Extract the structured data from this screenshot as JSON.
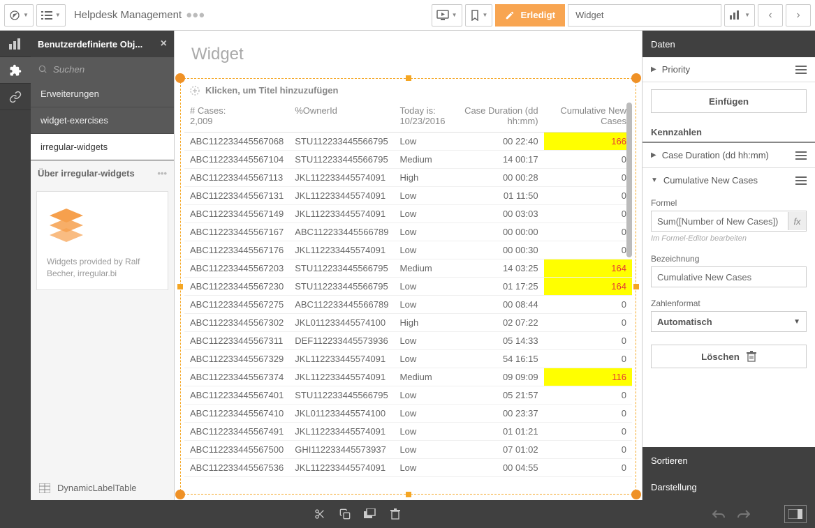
{
  "app_title": "Helpdesk Management",
  "toolbar": {
    "done_label": "Erledigt",
    "widget_label": "Widget"
  },
  "left_panel": {
    "header": "Benutzerdefinierte Obj...",
    "search_placeholder": "Suchen",
    "nav": {
      "erweiterungen": "Erweiterungen",
      "widget_exercises": "widget-exercises",
      "irregular_widgets": "irregular-widgets"
    },
    "about_header": "Über irregular-widgets",
    "about_text": "Widgets provided by Ralf Becher, irregular.bi",
    "content_item": "DynamicLabelTable"
  },
  "canvas": {
    "page_title": "Widget",
    "click_title": "Klicken, um Titel hinzuzufügen",
    "headers": {
      "cases": "# Cases:",
      "cases_count": "2,009",
      "owner": "%OwnerId",
      "today": "Today is:",
      "today_date": "10/23/2016",
      "duration": "Case Duration (dd hh:mm)",
      "cumulative": "Cumulative New Cases"
    },
    "rows": [
      {
        "c1": "ABC112233445567068",
        "c2": "STU112233445566795",
        "c3": "Low",
        "c4": "00 22:40",
        "c5": "166",
        "hl": true
      },
      {
        "c1": "ABC112233445567104",
        "c2": "STU112233445566795",
        "c3": "Medium",
        "c4": "14 00:17",
        "c5": "0",
        "hl": false
      },
      {
        "c1": "ABC112233445567113",
        "c2": "JKL112233445574091",
        "c3": "High",
        "c4": "00 00:28",
        "c5": "0",
        "hl": false
      },
      {
        "c1": "ABC112233445567131",
        "c2": "JKL112233445574091",
        "c3": "Low",
        "c4": "01 11:50",
        "c5": "0",
        "hl": false
      },
      {
        "c1": "ABC112233445567149",
        "c2": "JKL112233445574091",
        "c3": "Low",
        "c4": "00 03:03",
        "c5": "0",
        "hl": false
      },
      {
        "c1": "ABC112233445567167",
        "c2": "ABC112233445566789",
        "c3": "Low",
        "c4": "00 00:00",
        "c5": "0",
        "hl": false
      },
      {
        "c1": "ABC112233445567176",
        "c2": "JKL112233445574091",
        "c3": "Low",
        "c4": "00 00:30",
        "c5": "0",
        "hl": false
      },
      {
        "c1": "ABC112233445567203",
        "c2": "STU112233445566795",
        "c3": "Medium",
        "c4": "14 03:25",
        "c5": "164",
        "hl": true
      },
      {
        "c1": "ABC112233445567230",
        "c2": "STU112233445566795",
        "c3": "Low",
        "c4": "01 17:25",
        "c5": "164",
        "hl": true
      },
      {
        "c1": "ABC112233445567275",
        "c2": "ABC112233445566789",
        "c3": "Low",
        "c4": "00 08:44",
        "c5": "0",
        "hl": false
      },
      {
        "c1": "ABC112233445567302",
        "c2": "JKL011233445574100",
        "c3": "High",
        "c4": "02 07:22",
        "c5": "0",
        "hl": false
      },
      {
        "c1": "ABC112233445567311",
        "c2": "DEF112233445573936",
        "c3": "Low",
        "c4": "05 14:33",
        "c5": "0",
        "hl": false
      },
      {
        "c1": "ABC112233445567329",
        "c2": "JKL112233445574091",
        "c3": "Low",
        "c4": "54 16:15",
        "c5": "0",
        "hl": false
      },
      {
        "c1": "ABC112233445567374",
        "c2": "JKL112233445574091",
        "c3": "Medium",
        "c4": "09 09:09",
        "c5": "116",
        "hl": true
      },
      {
        "c1": "ABC112233445567401",
        "c2": "STU112233445566795",
        "c3": "Low",
        "c4": "05 21:57",
        "c5": "0",
        "hl": false
      },
      {
        "c1": "ABC112233445567410",
        "c2": "JKL011233445574100",
        "c3": "Low",
        "c4": "00 23:37",
        "c5": "0",
        "hl": false
      },
      {
        "c1": "ABC112233445567491",
        "c2": "JKL112233445574091",
        "c3": "Low",
        "c4": "01 01:21",
        "c5": "0",
        "hl": false
      },
      {
        "c1": "ABC112233445567500",
        "c2": "GHI112233445573937",
        "c3": "Low",
        "c4": "07 01:02",
        "c5": "0",
        "hl": false
      },
      {
        "c1": "ABC112233445567536",
        "c2": "JKL112233445574091",
        "c3": "Low",
        "c4": "00 04:55",
        "c5": "0",
        "hl": false
      }
    ]
  },
  "right_panel": {
    "daten": "Daten",
    "priority": "Priority",
    "einfuegen": "Einfügen",
    "kennzahlen": "Kennzahlen",
    "case_duration": "Case Duration (dd hh:mm)",
    "cumulative": "Cumulative New Cases",
    "formel": "Formel",
    "formel_value": "Sum([Number of New Cases])",
    "formel_helper": "Im Formel-Editor bearbeiten",
    "bezeichnung": "Bezeichnung",
    "bezeichnung_value": "Cumulative New Cases",
    "zahlenformat": "Zahlenformat",
    "zahlenformat_value": "Automatisch",
    "loeschen": "Löschen",
    "sortieren": "Sortieren",
    "darstellung": "Darstellung"
  }
}
